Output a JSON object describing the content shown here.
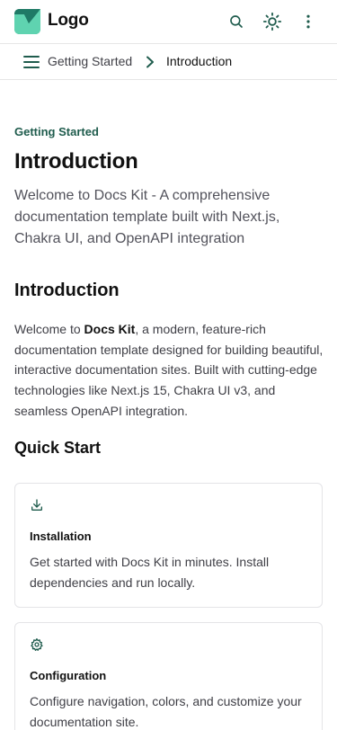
{
  "header": {
    "logo_text": "Logo",
    "brand_color": "#1f7a66",
    "icons": [
      "search-icon",
      "sun-icon",
      "more-vertical-icon"
    ]
  },
  "breadcrumb": {
    "parent": "Getting Started",
    "current": "Introduction"
  },
  "page": {
    "eyebrow": "Getting Started",
    "title": "Introduction",
    "subtitle": "Welcome to Docs Kit - A comprehensive documentation template built with Next.js, Chakra UI, and OpenAPI integration"
  },
  "intro": {
    "heading": "Introduction",
    "text_before": "Welcome to ",
    "text_bold": "Docs Kit",
    "text_after": ", a modern, feature-rich documentation template designed for building beautiful, interactive documentation sites. Built with cutting-edge technologies like Next.js 15, Chakra UI v3, and seamless OpenAPI integration."
  },
  "quick_start": {
    "heading": "Quick Start",
    "cards": [
      {
        "icon": "download-icon",
        "title": "Installation",
        "description": "Get started with Docs Kit in minutes. Install dependencies and run locally."
      },
      {
        "icon": "gear-icon",
        "title": "Configuration",
        "description": "Configure navigation, colors, and customize your documentation site."
      }
    ]
  }
}
